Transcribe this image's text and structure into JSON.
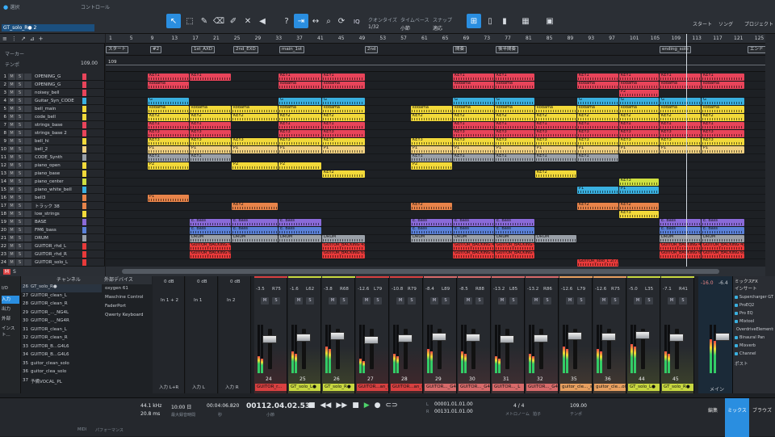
{
  "toolbar": {
    "arrange_label": "選択",
    "control_label": "コントロール",
    "track_name": "GT_solo_R● 2",
    "quantize_label": "クオンタイズ",
    "quantize_value": "1/32",
    "timebase_label": "タイムベース",
    "timebase_value": "小節",
    "snap_label": "スナップ",
    "snap_value": "適応",
    "start_label": "スタート",
    "song_label": "ソング",
    "project_label": "プロジェクト",
    "iq_label": "IQ"
  },
  "left": {
    "marker_label": "マーカー",
    "tempo_label": "テンポ",
    "tempo_value": "109.00"
  },
  "ruler": [
    "1",
    "5",
    "9",
    "13",
    "17",
    "21",
    "25",
    "29",
    "33",
    "37",
    "41",
    "45",
    "49",
    "53",
    "57",
    "61",
    "65",
    "69",
    "73",
    "77",
    "81",
    "85",
    "89",
    "93",
    "97",
    "101",
    "105",
    "109",
    "113",
    "117",
    "121",
    "125",
    "129"
  ],
  "tempo_track_value": "109",
  "markers": [
    "スタート",
    "#2",
    "1st_AXD",
    "2nd_EXD",
    "main_1st",
    "2nd",
    "間奏",
    "後半間奏",
    "ending_solo",
    "エンド"
  ],
  "tracks": [
    {
      "n": "1",
      "name": "OPENING_G",
      "color": "#e8445a"
    },
    {
      "n": "2",
      "name": "OPENING_G",
      "color": "#e8445a"
    },
    {
      "n": "3",
      "name": "noisey_bell",
      "color": "#e8445a"
    },
    {
      "n": "4",
      "name": "Guitar_Syn_CODE",
      "color": "#3ab0e0"
    },
    {
      "n": "5",
      "name": "bell_main",
      "color": "#f2d93a"
    },
    {
      "n": "6",
      "name": "code_bell",
      "color": "#f2d93a"
    },
    {
      "n": "7",
      "name": "strings_base",
      "color": "#e8445a"
    },
    {
      "n": "8",
      "name": "strings_base 2",
      "color": "#e8445a"
    },
    {
      "n": "9",
      "name": "bell_hi",
      "color": "#f2d93a"
    },
    {
      "n": "10",
      "name": "bell_2",
      "color": "#f0d080"
    },
    {
      "n": "11",
      "name": "CODE_Synth",
      "color": "#9aa0a8"
    },
    {
      "n": "12",
      "name": "piano_open",
      "color": "#f2d93a"
    },
    {
      "n": "13",
      "name": "piano_base",
      "color": "#f2d93a"
    },
    {
      "n": "14",
      "name": "piano_center",
      "color": "#cfe040"
    },
    {
      "n": "15",
      "name": "piano_white_bell",
      "color": "#3ab0e0"
    },
    {
      "n": "16",
      "name": "bell3",
      "color": "#e8844a"
    },
    {
      "n": "17",
      "name": "トラック 38",
      "color": "#e8844a"
    },
    {
      "n": "18",
      "name": "low_strings",
      "color": "#f2d93a"
    },
    {
      "n": "19",
      "name": "BASE",
      "color": "#8a6ad8"
    },
    {
      "n": "20",
      "name": "FM6_bass",
      "color": "#5a80d8"
    },
    {
      "n": "21",
      "name": "DRUM",
      "color": "#9aa0a8"
    },
    {
      "n": "22",
      "name": "GUITOR_rhd_L",
      "color": "#e83a3a"
    },
    {
      "n": "23",
      "name": "GUITOR_rhd_R",
      "color": "#e83a3a"
    },
    {
      "n": "24",
      "name": "GUITOR_solo_L",
      "color": "#e83a3a"
    }
  ],
  "clip_labels": {
    "g": "G",
    "key1": "KEY1",
    "key2": "KEY2",
    "key3": "KEY3",
    "kodama": "kodama",
    "p1": "P1",
    "p2": "P2",
    "ebass": "E. Bass",
    "drum": "DRUM",
    "track7": "トラック 7",
    "gb": "GUITOR_BACKING 4(13)",
    "gb2": "GUITOR_BACKING 6(12)",
    "gbl": "GUITOR_BACKING 7",
    "gsolo": "GUITOR_solo_L 2(7)"
  },
  "bottom_tab_labels": {
    "ms": "M",
    "ss": "S",
    "summary": "オーバービュー"
  },
  "mixer_left": {
    "channel_label": "チャンネル",
    "ext_label": "外部デバイス",
    "rows": [
      {
        "n": "26",
        "name": "GT_solo_R●"
      },
      {
        "n": "27",
        "name": "GUITOR_clean_L"
      },
      {
        "n": "28",
        "name": "GUITOR_clean_R"
      },
      {
        "n": "29",
        "name": "GUITOR_..._NG4L"
      },
      {
        "n": "30",
        "name": "GUITOR_..._NG4R"
      },
      {
        "n": "31",
        "name": "GUITOR_clean_L"
      },
      {
        "n": "32",
        "name": "GUITOR_clean_R"
      },
      {
        "n": "33",
        "name": "GUITOR_B...G4L6"
      },
      {
        "n": "34",
        "name": "GUITOR_B...G4L6"
      },
      {
        "n": "35",
        "name": "guitor_clean_solo"
      },
      {
        "n": "36",
        "name": "guitor_clea_solo"
      },
      {
        "n": "37",
        "name": "予備VOCAL_PL"
      }
    ],
    "devices": [
      "oxygen 61",
      "Maschine Control",
      "FaderPort",
      "Qwerty Keyboard"
    ],
    "side": [
      "I/O",
      "入力",
      "出力",
      "外部",
      "インスト..."
    ]
  },
  "inputs": [
    {
      "db": "0 dB",
      "name": "In 1 + 2",
      "route": "入力 L+R"
    },
    {
      "db": "0 dB",
      "name": "In 1",
      "route": "入力 L"
    },
    {
      "db": "0 dB",
      "name": "In 2",
      "route": "入力 R"
    }
  ],
  "channels": [
    {
      "db": "-3.5",
      "pan": "R75",
      "num": "24",
      "name": "GUITOR_r...",
      "color": "#d84040"
    },
    {
      "db": "-1.6",
      "pan": "L62",
      "num": "25",
      "name": "GT_solo_L●",
      "color": "#c8d840"
    },
    {
      "db": "-3.8",
      "pan": "R68",
      "num": "26",
      "name": "GT_solo_R●",
      "color": "#c8d840"
    },
    {
      "db": "-12.6",
      "pan": "L79",
      "num": "27",
      "name": "GUITOR...an_L",
      "color": "#d84040"
    },
    {
      "db": "-10.8",
      "pan": "R79",
      "num": "28",
      "name": "GUITOR...an_R",
      "color": "#d84040"
    },
    {
      "db": "-8.4",
      "pan": "L89",
      "num": "29",
      "name": "GUITOR..._G4L",
      "color": "#d86a6a"
    },
    {
      "db": "-8.5",
      "pan": "R88",
      "num": "30",
      "name": "GUITOR..._G4R",
      "color": "#d86a6a"
    },
    {
      "db": "-13.2",
      "pan": "L85",
      "num": "31",
      "name": "GUITOR..._L",
      "color": "#d86a6a"
    },
    {
      "db": "-13.2",
      "pan": "R86",
      "num": "32",
      "name": "GUITOR..._G4L",
      "color": "#d86a6a"
    },
    {
      "db": "-12.6",
      "pan": "L79",
      "num": "35",
      "name": "guitor_cle..._solo",
      "color": "#e8a060"
    },
    {
      "db": "-12.6",
      "pan": "R75",
      "num": "36",
      "name": "guitor_cle...olo2",
      "color": "#e8a060"
    },
    {
      "db": "-5.0",
      "pan": "L35",
      "num": "44",
      "name": "GT_solo_L●",
      "color": "#c8d840"
    },
    {
      "db": "-7.1",
      "pan": "R41",
      "num": "45",
      "name": "GT_solo_R●",
      "color": "#c8d840"
    }
  ],
  "main": {
    "db": "-16.0",
    "db2": "-6.4",
    "name": "メイン",
    "vals": [
      "0.6",
      "-12"
    ]
  },
  "fx": {
    "title": "ミックスFX",
    "insert": "インサート",
    "items": [
      "Supercharger GT",
      "ProEQ2",
      "Pro EQ",
      "Mixtool",
      "OverdriveElements",
      "Binaural Pan",
      "Mixverb",
      "Channel"
    ],
    "post": "ポスト"
  },
  "transport": {
    "midi": "MIDI",
    "perf": "パフォーマンス",
    "rate": "44.1 kHz",
    "latency": "20.8 ms",
    "max_time": "10:00 日",
    "max_label": "最大録音時間",
    "time": "00:04:06.820",
    "time_label": "秒",
    "bars": "00112.04.02.53",
    "bars_label": "小節",
    "loop_l": "00001.01.01.00",
    "loop_r": "00131.01.01.00",
    "loop_label": "L",
    "loop_label2": "R",
    "sig": "4 / 4",
    "sig_label": "拍子",
    "metro_label": "メトロノーム",
    "tempo": "109.00",
    "tempo_label": "テンポ",
    "edit": "編集",
    "mix": "ミックス",
    "browse": "ブラウズ"
  }
}
